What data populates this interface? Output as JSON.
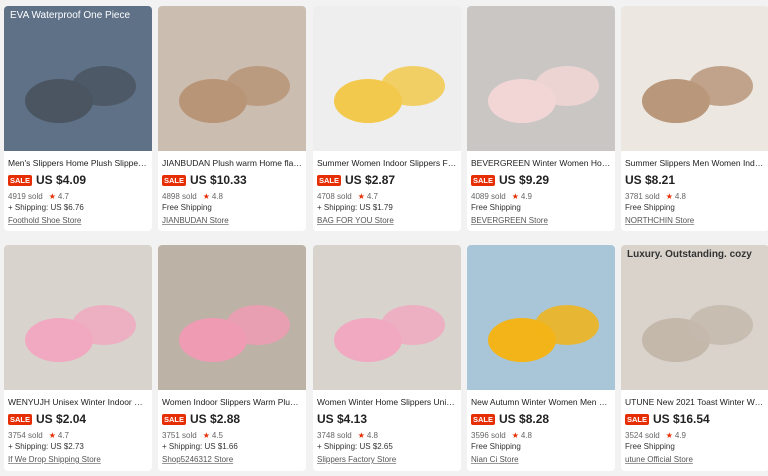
{
  "products": [
    {
      "title": "Men's Slippers Home Plush Slipper…",
      "sale": true,
      "sale_label": "SALE",
      "price": "US $4.09",
      "sold": "4919 sold",
      "rating": "4.7",
      "shipping": "+ Shipping: US $6.76",
      "store": "Foothold Shoe Store",
      "image_text": "EVA Waterproof One Piece",
      "bg": "#5e7187",
      "shoe": "#4b5561"
    },
    {
      "title": "JIANBUDAN Plush warm Home flat…",
      "sale": true,
      "sale_label": "SALE",
      "price": "US $10.33",
      "sold": "4898 sold",
      "rating": "4.8",
      "shipping": "Free Shipping",
      "store": "JIANBUDAN Store",
      "bg": "#cbbdb0",
      "shoe": "#b99578"
    },
    {
      "title": "Summer Women Indoor Slippers F…",
      "sale": true,
      "sale_label": "SALE",
      "price": "US $2.87",
      "sold": "4708 sold",
      "rating": "4.7",
      "shipping": "+ Shipping: US $1.79",
      "store": "BAG FOR YOU Store",
      "bg": "#eeeeee",
      "shoe": "#f2c94c"
    },
    {
      "title": "BEVERGREEN Winter Women Hous…",
      "sale": true,
      "sale_label": "SALE",
      "price": "US $9.29",
      "sold": "4089 sold",
      "rating": "4.9",
      "shipping": "Free Shipping",
      "store": "BEVERGREEN Store",
      "bg": "#c9c6c4",
      "shoe": "#f2d6d6"
    },
    {
      "title": "Summer Slippers Men Women Ind…",
      "sale": false,
      "sale_label": "",
      "price": "US $8.21",
      "sold": "3781 sold",
      "rating": "4.8",
      "shipping": "Free Shipping",
      "store": "NORTHCHIN Store",
      "bg": "#ece7e1",
      "shoe": "#b8977a"
    },
    {
      "title": "WENYUJH Unisex Winter Indoor W…",
      "sale": true,
      "sale_label": "SALE",
      "price": "US $2.04",
      "sold": "3754 sold",
      "rating": "4.7",
      "shipping": "+ Shipping: US $2.73",
      "store": "If We Drop Shipping Store",
      "bg": "#d8d3cd",
      "shoe": "#f1a9c1"
    },
    {
      "title": "Women Indoor Slippers Warm Plu…",
      "sale": true,
      "sale_label": "SALE",
      "price": "US $2.88",
      "sold": "3751 sold",
      "rating": "4.5",
      "shipping": "+ Shipping: US $1.66",
      "store": "Shop5246312 Store",
      "bg": "#bdb2a6",
      "shoe": "#ee9bb3"
    },
    {
      "title": "Women Winter Home Slippers Uni…",
      "sale": false,
      "sale_label": "",
      "price": "US $4.13",
      "sold": "3748 sold",
      "rating": "4.8",
      "shipping": "+ Shipping: US $2.65",
      "store": "Slippers Factory Store",
      "bg": "#d8d3cd",
      "shoe": "#f1a9c1"
    },
    {
      "title": "New Autumn Winter Women Men …",
      "sale": true,
      "sale_label": "SALE",
      "price": "US $8.28",
      "sold": "3596 sold",
      "rating": "4.8",
      "shipping": "Free Shipping",
      "store": "Nian Ci Store",
      "bg": "#a9c6d8",
      "shoe": "#f2b418"
    },
    {
      "title": "UTUNE New 2021 Toast Winter Wo…",
      "sale": true,
      "sale_label": "SALE",
      "price": "US $16.54",
      "sold": "3524 sold",
      "rating": "4.9",
      "shipping": "Free Shipping",
      "store": "utune Official Store",
      "image_text": "Luxury. Outstanding. cozy",
      "bg": "#d9d3cc",
      "shoe": "#c4b8ab"
    }
  ]
}
